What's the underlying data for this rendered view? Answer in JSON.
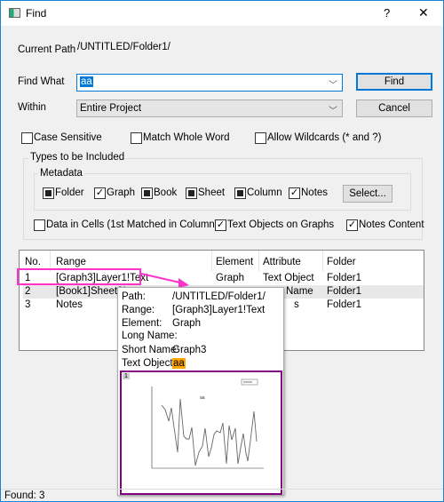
{
  "window": {
    "title": "Find",
    "help": "?",
    "close": "✕"
  },
  "current_path": {
    "label": "Current Path",
    "value": "/UNTITLED/Folder1/"
  },
  "find_what": {
    "label": "Find What",
    "value": "aa"
  },
  "within": {
    "label": "Within",
    "value": "Entire Project"
  },
  "buttons": {
    "find": "Find",
    "cancel": "Cancel",
    "select": "Select..."
  },
  "options": [
    {
      "label": "Case Sensitive",
      "checked": false
    },
    {
      "label": "Match Whole Word",
      "checked": false
    },
    {
      "label": "Allow Wildcards (* and ?)",
      "checked": false
    }
  ],
  "types_group": "Types to be Included",
  "metadata_group": "Metadata",
  "metadata": [
    {
      "label": "Folder",
      "state": "indeterminate"
    },
    {
      "label": "Graph",
      "state": "checked"
    },
    {
      "label": "Book",
      "state": "indeterminate"
    },
    {
      "label": "Sheet",
      "state": "indeterminate"
    },
    {
      "label": "Column",
      "state": "indeterminate"
    },
    {
      "label": "Notes",
      "state": "checked"
    }
  ],
  "extra": [
    {
      "label": "Data in Cells (1st Matched in Column)",
      "checked": false
    },
    {
      "label": "Text Objects on Graphs",
      "checked": true
    },
    {
      "label": "Notes Content",
      "checked": true
    }
  ],
  "table": {
    "headers": [
      "No.",
      "Range",
      "Element",
      "Attribute",
      "Folder"
    ],
    "rows": [
      [
        "1",
        "[Graph3]Layer1!Text",
        "Graph",
        "Text Object",
        "Folder1"
      ],
      [
        "2",
        "[Book1]Sheet2!",
        "",
        "Name",
        "Folder1"
      ],
      [
        "3",
        "Notes",
        "",
        "s",
        "Folder1"
      ]
    ]
  },
  "tooltip": {
    "rows": [
      {
        "k": "Path:",
        "v": "/UNTITLED/Folder1/"
      },
      {
        "k": "Range:",
        "v": "[Graph3]Layer1!Text"
      },
      {
        "k": "Element:",
        "v": "Graph"
      },
      {
        "k": "Long Name:",
        "v": ""
      },
      {
        "k": "Short Name:",
        "v": "Graph3"
      }
    ],
    "text_object_label": "Text Object:",
    "text_object_value": "aa",
    "thumb_layer": "1",
    "thumb_text": "aa"
  },
  "status": "Found: 3",
  "colors": {
    "accent": "#0078d7",
    "highlight_box": "#ff33cc",
    "thumb_border": "#800080",
    "match_bg": "#ffa500"
  }
}
